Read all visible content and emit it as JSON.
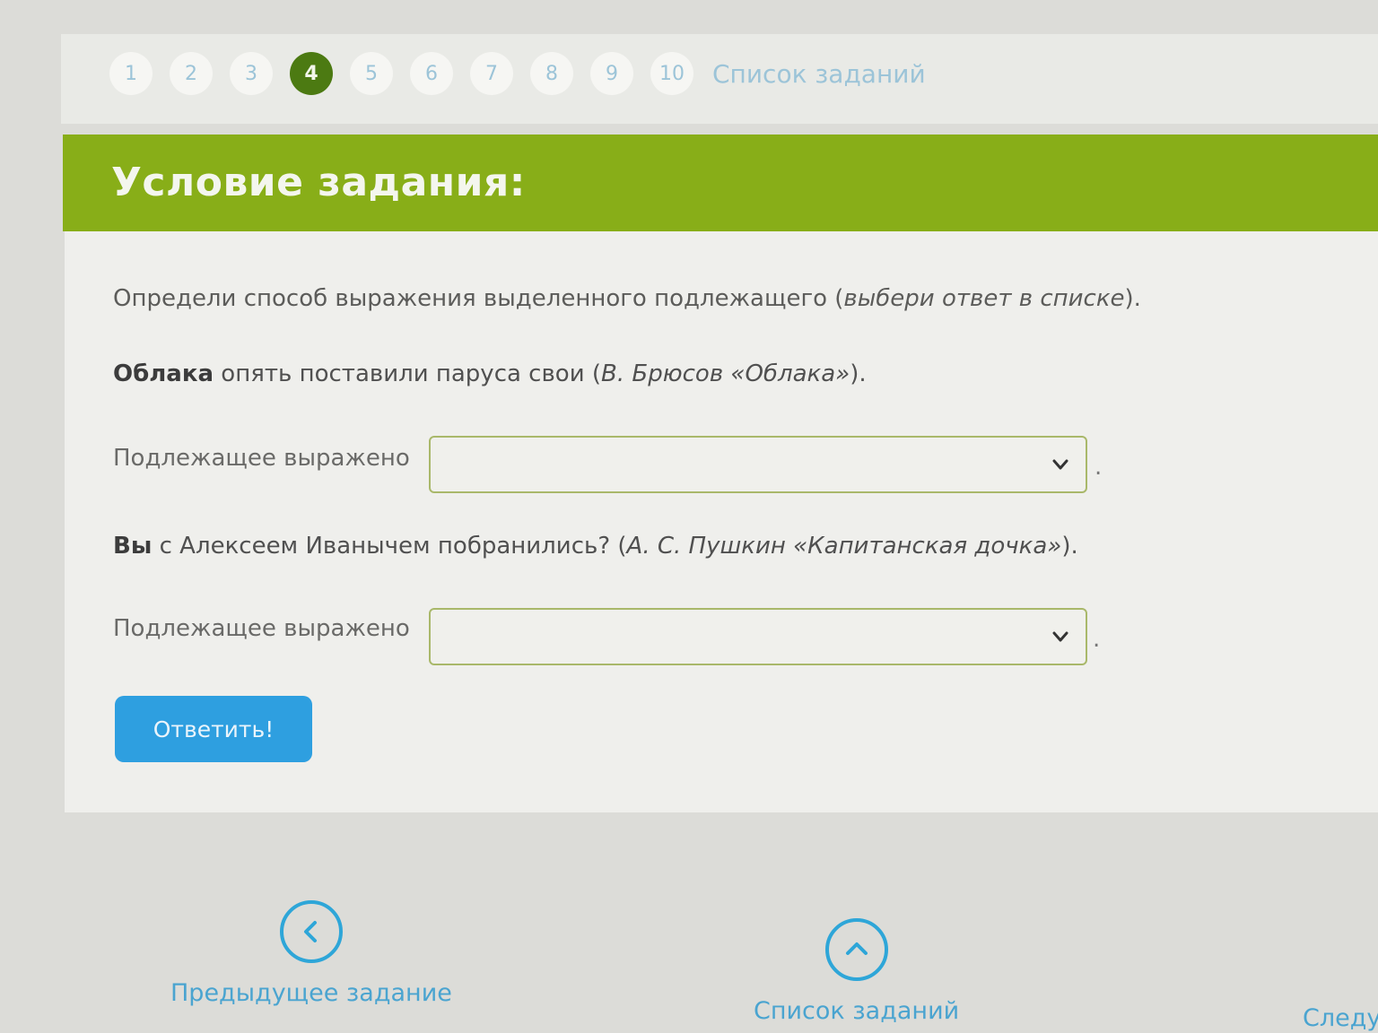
{
  "pager": {
    "pages": [
      "1",
      "2",
      "3",
      "4",
      "5",
      "6",
      "7",
      "8",
      "9",
      "10"
    ],
    "active_page": "4",
    "task_list_label": "Список заданий"
  },
  "header": {
    "title": "Условие задания:"
  },
  "task": {
    "prompt_main": "Определи способ выражения выделенного подлежащего (",
    "prompt_italic": "выбери ответ в списке",
    "prompt_end": ").",
    "sentence1": {
      "bold": "Облака",
      "text": " опять поставили паруса свои (",
      "source_italic": "В. Брюсов «Облака»",
      "end": ")."
    },
    "label1": "Подлежащее выражено",
    "select1_value": "",
    "sentence2": {
      "bold": "Вы",
      "text": " с Алексеем Иванычем побранились? (",
      "source_italic": "А. С. Пушкин «Капитанская дочка»",
      "end": ")."
    },
    "label2": "Подлежащее выражено",
    "select2_value": "",
    "answer_button": "Ответить!"
  },
  "bottom_nav": {
    "prev_label": "Предыдущее задание",
    "list_label": "Список заданий",
    "next_label": "Следу"
  },
  "colors": {
    "accent_green": "#88ae18",
    "active_page": "#4c7a12",
    "button_blue": "#2e9fe0",
    "link_blue": "#4aa4d0"
  },
  "icons": {
    "prev": "chevron-left-circle-icon",
    "list": "chevron-up-circle-icon",
    "select": "chevron-down-icon"
  }
}
